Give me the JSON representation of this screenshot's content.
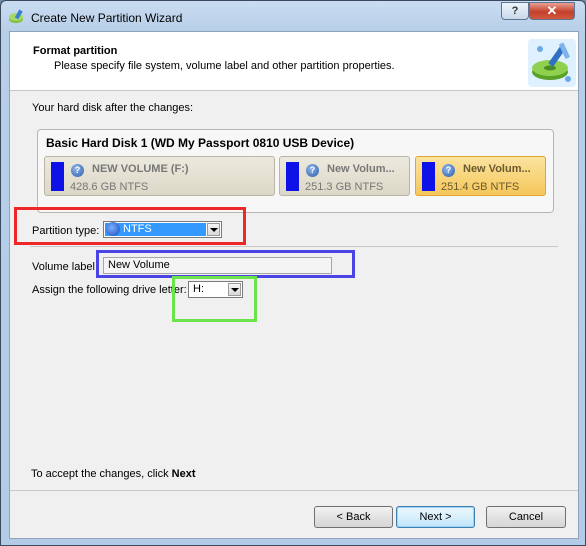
{
  "window": {
    "title": "Create New Partition Wizard",
    "help_label": "?",
    "close_label": "✕"
  },
  "header": {
    "title": "Format partition",
    "subtitle": "Please specify file system, volume label and other partition properties."
  },
  "disk_section": {
    "label": "Your hard disk after the changes:",
    "disk_name": "Basic Hard Disk 1 (WD My Passport 0810 USB Device)",
    "partitions": [
      {
        "name": "NEW VOLUME (F:)",
        "size": "428.6 GB NTFS",
        "selected": false
      },
      {
        "name": "New Volum...",
        "size": "251.3 GB NTFS",
        "selected": false
      },
      {
        "name": "New Volum...",
        "size": "251.4 GB NTFS",
        "selected": true
      }
    ]
  },
  "form": {
    "partition_type_label": "Partition type:",
    "partition_type_value": "NTFS",
    "volume_label_label": "Volume label:",
    "volume_label_value": "New Volume",
    "drive_letter_label": "Assign the following drive letter:",
    "drive_letter_value": "H:"
  },
  "footer": {
    "instruction_prefix": "To accept the changes, click ",
    "instruction_bold": "Next",
    "back_label": "< Back",
    "next_label": "Next >",
    "cancel_label": "Cancel"
  },
  "colors": {
    "highlight_red": "#ee2828",
    "highlight_blue": "#4a44e4",
    "highlight_green": "#6be34a",
    "partition_bar": "#0f12e6",
    "selected_partition": "#f6c75a"
  },
  "icons": {
    "app": "partition-wizard-icon",
    "header_art": "disk-wizard-icon",
    "partition_help": "question-icon",
    "filesystem": "ntfs-icon"
  }
}
